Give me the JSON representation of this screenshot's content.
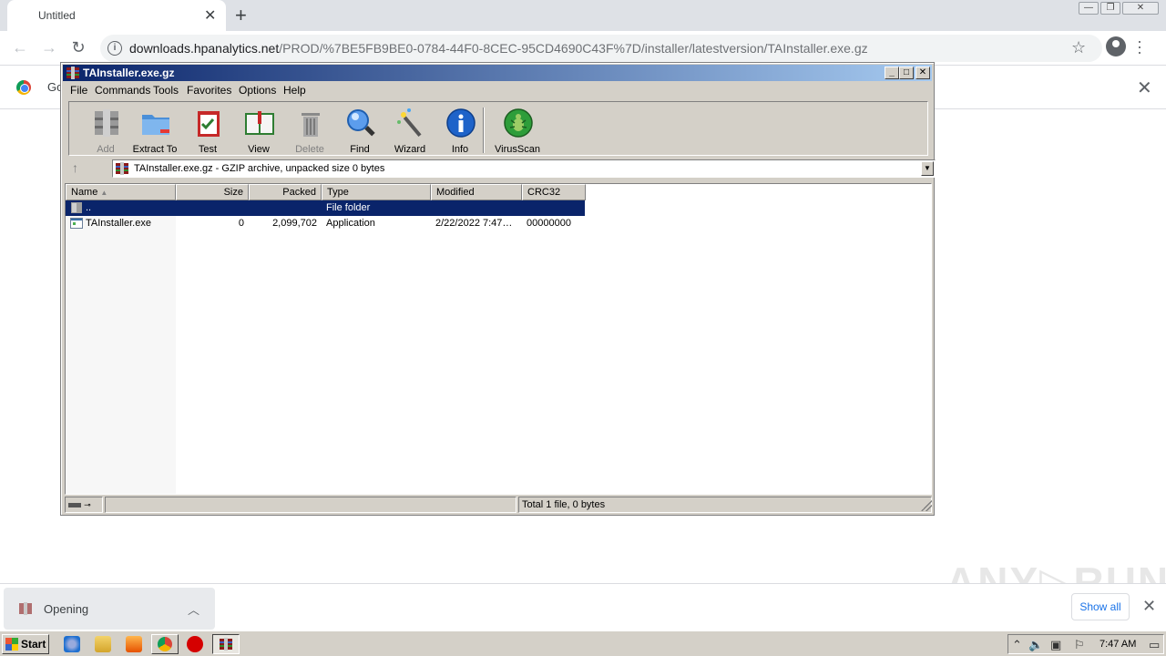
{
  "browser": {
    "tab_title": "Untitled",
    "tab_close": "✕",
    "new_tab": "+",
    "url_host": "downloads.hpanalytics.net",
    "url_path": "/PROD/%7BE5FB9BE0-0784-44F0-8CEC-95CD4690C43F%7D/installer/latestversion/TAInstaller.exe.gz",
    "infobar_text": "Go",
    "infobar_close": "✕",
    "window_minimize": "—",
    "window_restore": "❐",
    "window_close": "✕"
  },
  "winrar": {
    "title": "TAInstaller.exe.gz",
    "menu": [
      "File",
      "Commands",
      "Tools",
      "Favorites",
      "Options",
      "Help"
    ],
    "toolbar": [
      {
        "label": "Add",
        "icon": "add-archive-icon",
        "enabled": false
      },
      {
        "label": "Extract To",
        "icon": "extract-folder-icon",
        "enabled": true
      },
      {
        "label": "Test",
        "icon": "test-clipboard-icon",
        "enabled": true
      },
      {
        "label": "View",
        "icon": "view-book-icon",
        "enabled": true
      },
      {
        "label": "Delete",
        "icon": "trash-icon",
        "enabled": false
      },
      {
        "label": "Find",
        "icon": "magnifier-icon",
        "enabled": true
      },
      {
        "label": "Wizard",
        "icon": "wand-icon",
        "enabled": true
      },
      {
        "label": "Info",
        "icon": "info-icon",
        "enabled": true
      },
      {
        "label": "VirusScan",
        "icon": "virus-scan-icon",
        "enabled": true
      }
    ],
    "address": "TAInstaller.exe.gz - GZIP archive, unpacked size 0 bytes",
    "columns": [
      "Name",
      "Size",
      "Packed",
      "Type",
      "Modified",
      "CRC32"
    ],
    "rows": [
      {
        "name": "..",
        "size": "",
        "packed": "",
        "type": "File folder",
        "modified": "",
        "crc": ""
      },
      {
        "name": "TAInstaller.exe",
        "size": "0",
        "packed": "2,099,702",
        "type": "Application",
        "modified": "2/22/2022 7:47…",
        "crc": "00000000"
      }
    ],
    "status_total": "Total 1 file, 0 bytes"
  },
  "shelf": {
    "download_status": "Opening",
    "show_all": "Show all",
    "close": "✕"
  },
  "taskbar": {
    "start": "Start",
    "clock": "7:47 AM"
  },
  "colors": {
    "title_gradient_start": "#0a246a",
    "selection": "#0a246a",
    "chrome_frame": "#dee1e6",
    "link_blue": "#1a73e8"
  }
}
